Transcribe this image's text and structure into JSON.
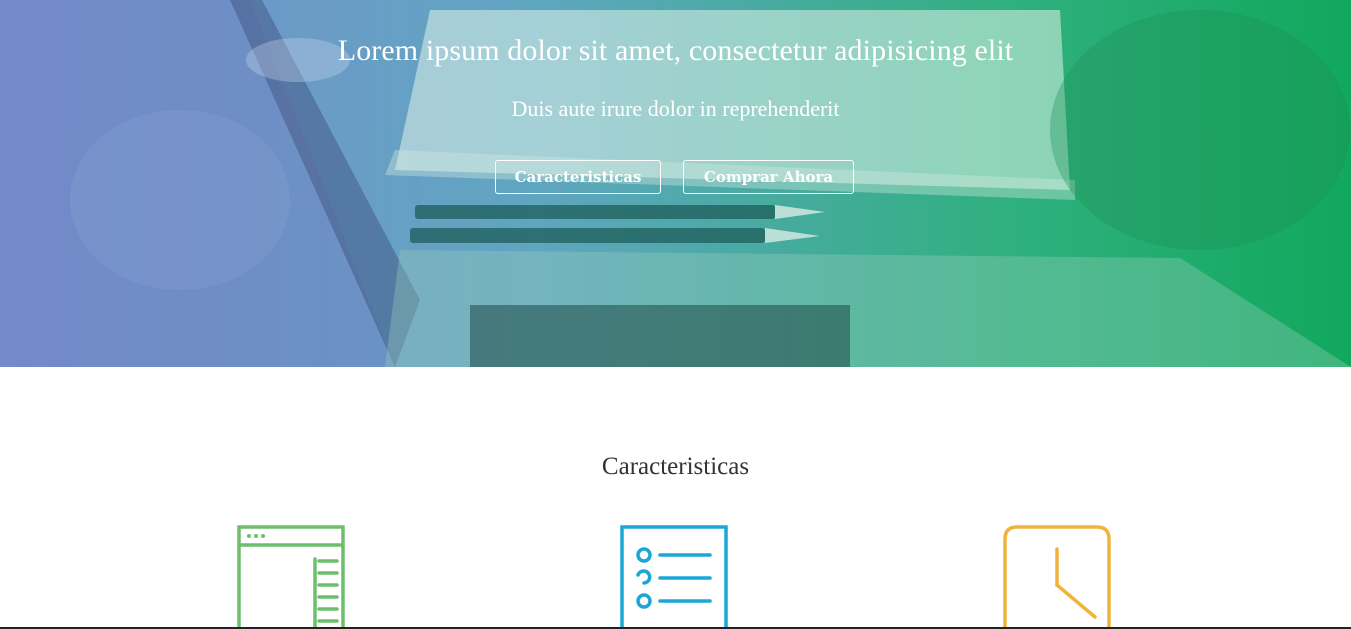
{
  "hero": {
    "title": "Lorem ipsum dolor sit amet, consectetur adipisicing elit",
    "subtitle": "Duis aute irure dolor in reprehenderit",
    "buttons": {
      "features_label": "Caracteristicas",
      "buy_label": "Comprar Ahora"
    },
    "gradient_colors": [
      "#7a8ed0",
      "#11a85d"
    ]
  },
  "features": {
    "title": "Caracteristicas",
    "icons": [
      {
        "name": "browser-layout-icon",
        "color": "#6cbf6c"
      },
      {
        "name": "checklist-icon",
        "color": "#1aa7d8"
      },
      {
        "name": "clock-icon",
        "color": "#f0b43c"
      }
    ]
  }
}
